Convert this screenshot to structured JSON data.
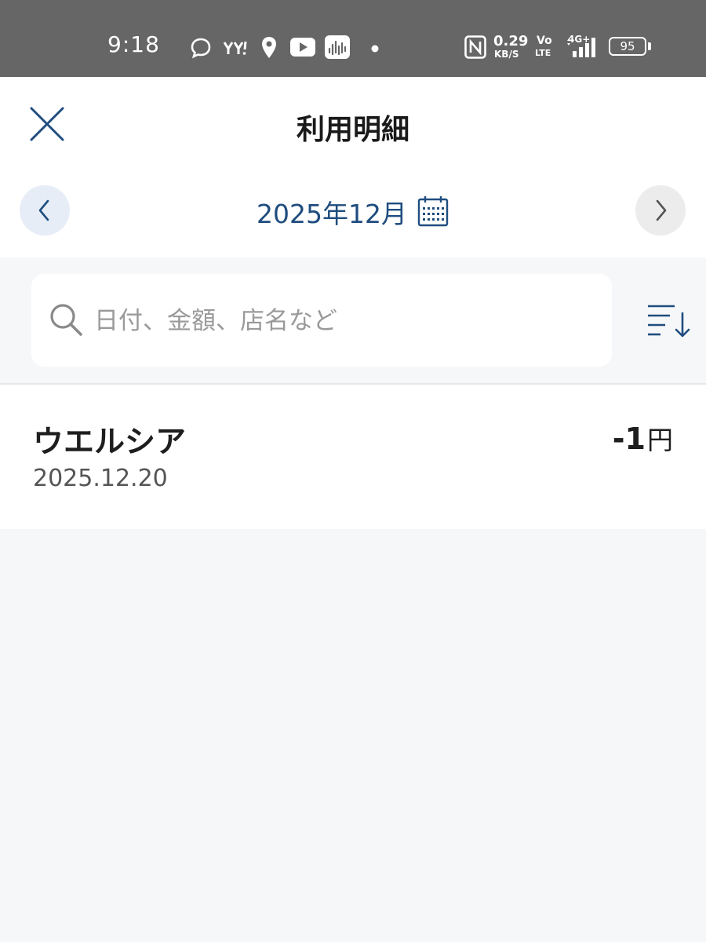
{
  "status_bar": {
    "time": "9:18",
    "network_speed_value": "0.29",
    "network_speed_unit": "KB/S",
    "volte_top": "Vo",
    "volte_bottom": "LTE",
    "signal_label": "4G+",
    "battery": "95",
    "colors": {
      "background": "#666666",
      "foreground": "#ffffff"
    }
  },
  "header": {
    "title": "利用明細",
    "month": "2025年12月"
  },
  "search": {
    "placeholder": "日付、金額、店名など"
  },
  "transactions": [
    {
      "merchant": "ウエルシア",
      "date": "2025.12.20",
      "amount": "-1",
      "unit": "円"
    }
  ],
  "icons": [
    "close-icon",
    "chevron-left-icon",
    "chevron-right-icon",
    "calendar-icon",
    "search-icon",
    "sort-icon"
  ],
  "colors": {
    "accent": "#1f4d7f",
    "background": "#f6f7f9",
    "card": "#ffffff"
  }
}
